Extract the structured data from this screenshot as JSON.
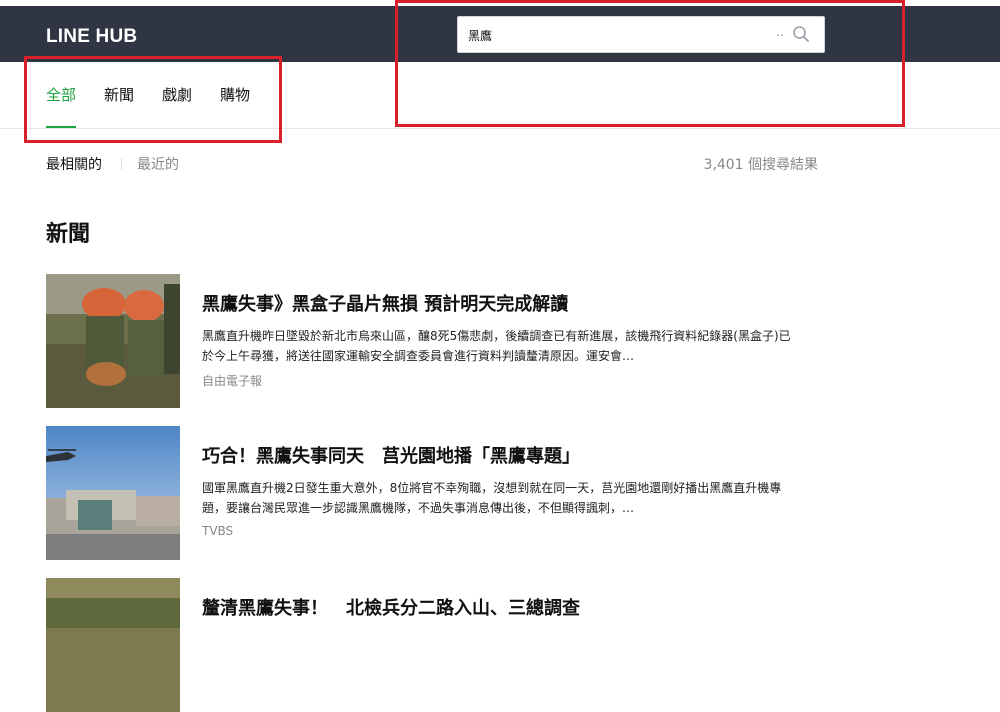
{
  "header": {
    "logo": "LINE HUB"
  },
  "search": {
    "query": "黑鷹",
    "more": ".."
  },
  "tabs": [
    {
      "label": "全部",
      "active": true
    },
    {
      "label": "新聞",
      "active": false
    },
    {
      "label": "戲劇",
      "active": false
    },
    {
      "label": "購物",
      "active": false
    }
  ],
  "sort": {
    "relevant": "最相關的",
    "recent": "最近的"
  },
  "results_count": "3,401 個搜尋結果",
  "section": {
    "title": "新聞"
  },
  "articles": [
    {
      "title": "黑鷹失事》黑盒子晶片無損 預計明天完成解讀",
      "desc": "黑鷹直升機昨日墜毀於新北市烏來山區，釀8死5傷悲劇，後續調查已有新進展，該機飛行資料紀錄器(黑盒子)已於今上午尋獲，將送往國家運輸安全調查委員會進行資料判讀釐清原因。運安會…",
      "source": "自由電子報"
    },
    {
      "title": "巧合！黑鷹失事同天　莒光園地播「黑鷹專題」",
      "desc": "國軍黑鷹直升機2日發生重大意外，8位將官不幸殉職，沒想到就在同一天，莒光園地還剛好播出黑鷹直升機專題，要讓台灣民眾進一步認識黑鷹機隊，不過失事消息傳出後，不但顯得諷刺，…",
      "source": "TVBS"
    },
    {
      "title": "釐清黑鷹失事！　北檢兵分二路入山、三總調查",
      "desc": "",
      "source": ""
    }
  ],
  "colors": {
    "header_bg": "#2f3542",
    "accent_green": "#1ea540",
    "annotation_red": "#d8222b"
  }
}
